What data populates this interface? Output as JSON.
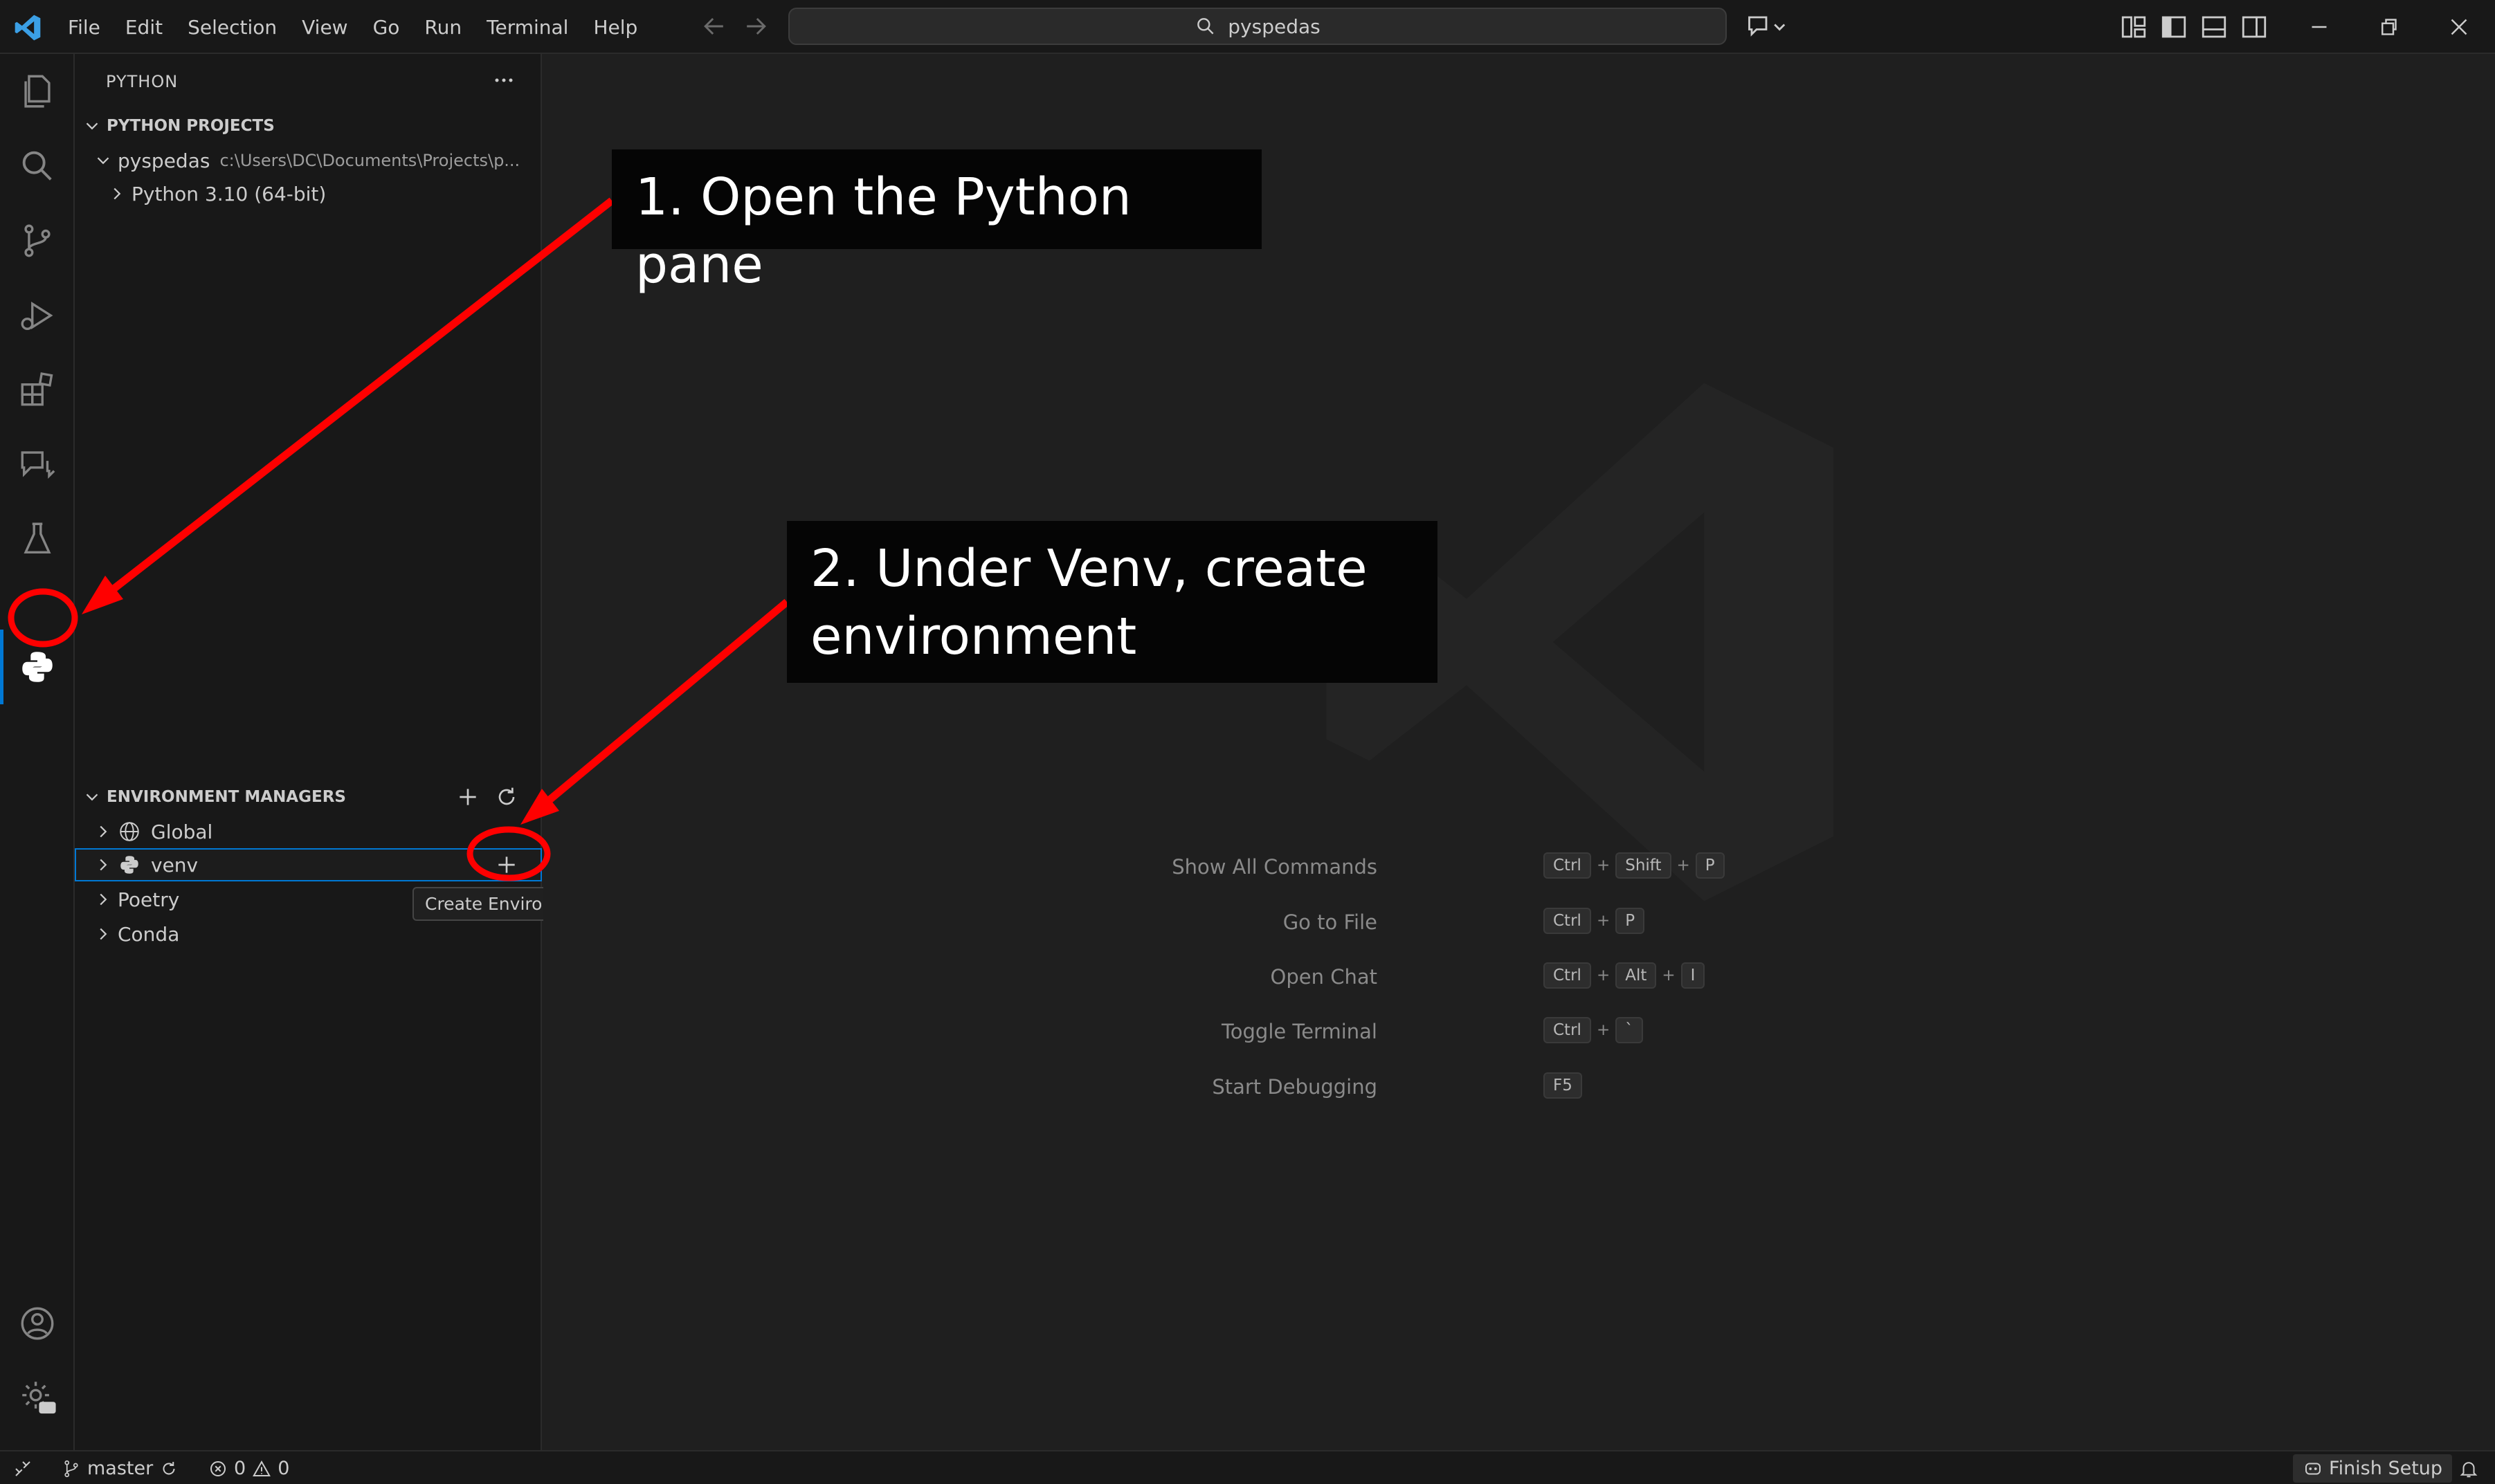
{
  "app": {
    "menu": [
      "File",
      "Edit",
      "Selection",
      "View",
      "Go",
      "Run",
      "Terminal",
      "Help"
    ],
    "search_text": "pyspedas"
  },
  "sidebar": {
    "title": "PYTHON",
    "projects_header": "PYTHON PROJECTS",
    "project": {
      "name": "pyspedas",
      "path": "c:\\Users\\DC\\Documents\\Projects\\p..."
    },
    "interpreter": "Python 3.10 (64-bit)",
    "env_header": "ENVIRONMENT MANAGERS",
    "env_managers": [
      "Global",
      "venv",
      "Poetry",
      "Conda"
    ],
    "tooltip": "Create Environment"
  },
  "editor": {
    "hints": [
      {
        "label": "Show All Commands",
        "keys": [
          "Ctrl",
          "Shift",
          "P"
        ]
      },
      {
        "label": "Go to File",
        "keys": [
          "Ctrl",
          "P"
        ]
      },
      {
        "label": "Open Chat",
        "keys": [
          "Ctrl",
          "Alt",
          "I"
        ]
      },
      {
        "label": "Toggle Terminal",
        "keys": [
          "Ctrl",
          "`"
        ]
      },
      {
        "label": "Start Debugging",
        "keys": [
          "F5"
        ]
      }
    ]
  },
  "statusbar": {
    "branch": "master",
    "errors": "0",
    "warnings": "0",
    "finish_setup": "Finish Setup"
  },
  "annotations": {
    "step1": "1. Open the Python pane",
    "step2_line1": "2. Under Venv, create",
    "step2_line2": "environment",
    "color": "#ff0000"
  }
}
